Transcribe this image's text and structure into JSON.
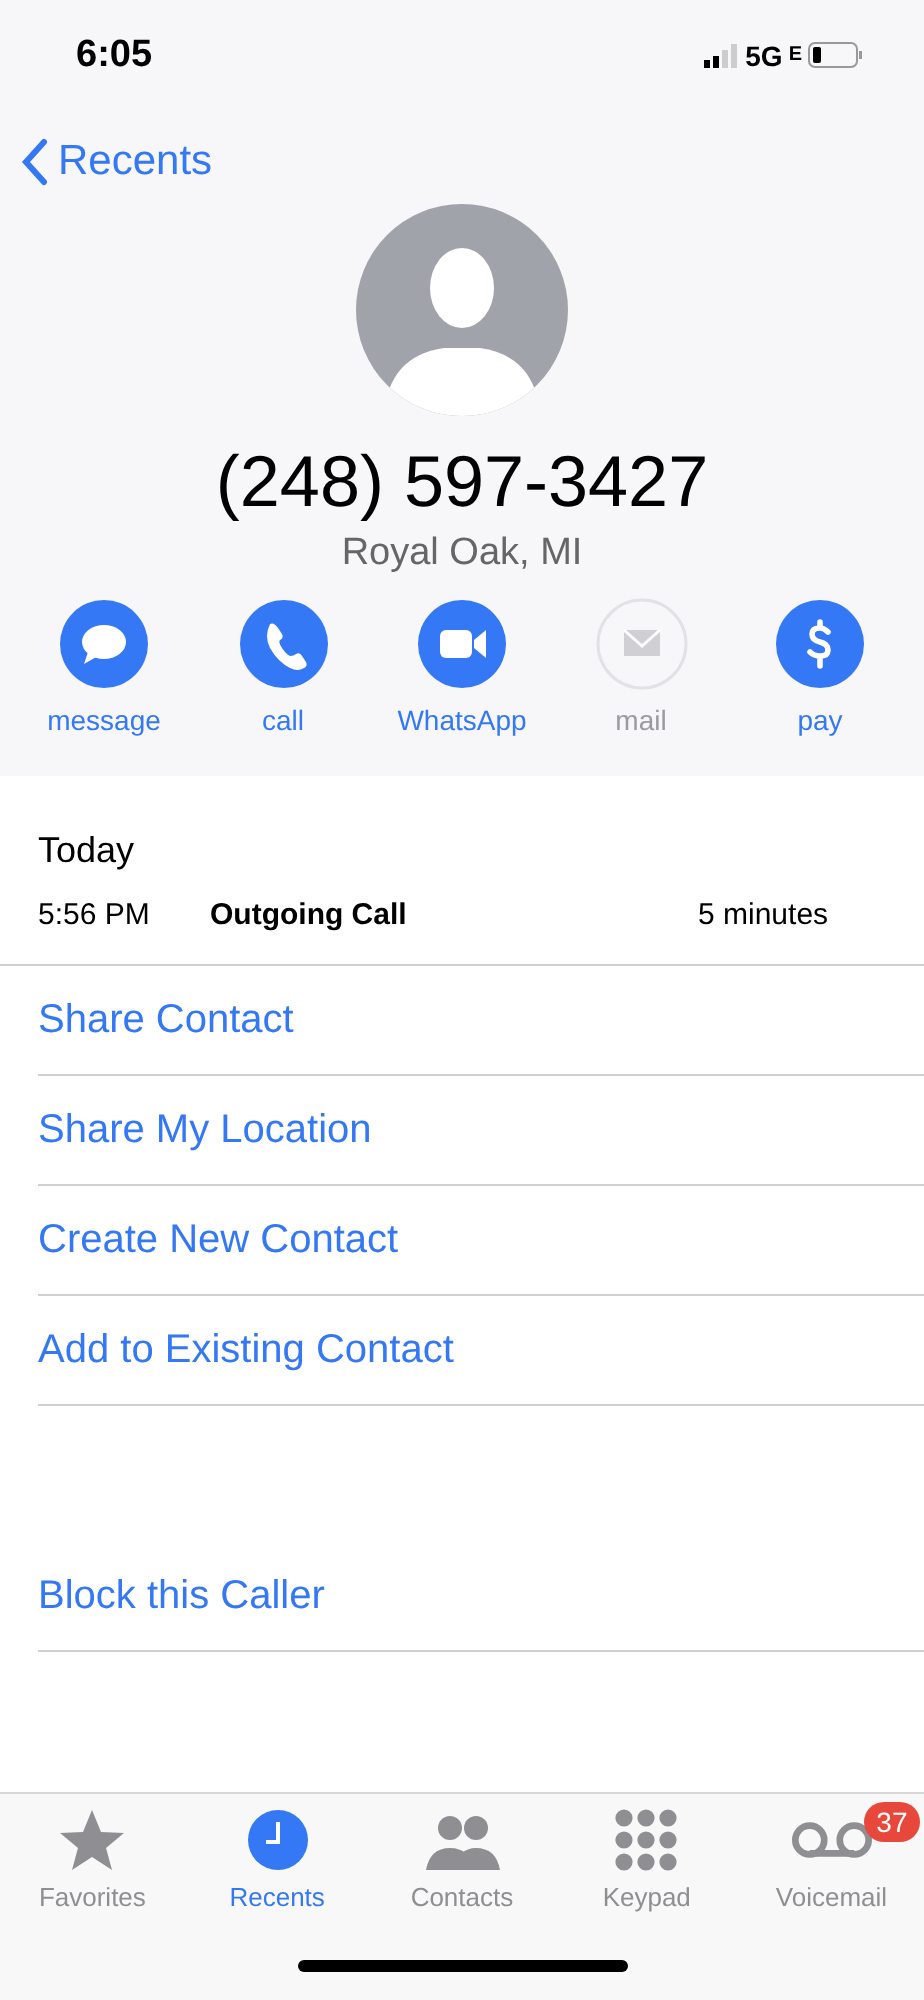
{
  "status_bar": {
    "time": "6:05",
    "network": "5G",
    "network_suffix": "E"
  },
  "nav": {
    "back_label": "Recents"
  },
  "contact": {
    "phone": "(248) 597-3427",
    "location": "Royal Oak, MI"
  },
  "actions": [
    {
      "kind": "message",
      "label": "message",
      "disabled": false
    },
    {
      "kind": "call",
      "label": "call",
      "disabled": false
    },
    {
      "kind": "video",
      "label": "WhatsApp",
      "disabled": false
    },
    {
      "kind": "mail",
      "label": "mail",
      "disabled": true
    },
    {
      "kind": "pay",
      "label": "pay",
      "disabled": false
    }
  ],
  "history": {
    "heading": "Today",
    "calls": [
      {
        "time": "5:56 PM",
        "type": "Outgoing Call",
        "duration": "5 minutes"
      }
    ]
  },
  "options": [
    {
      "label": "Share Contact"
    },
    {
      "label": "Share My Location"
    },
    {
      "label": "Create New Contact"
    },
    {
      "label": "Add to Existing Contact"
    }
  ],
  "block": {
    "label": "Block this Caller"
  },
  "tabs": [
    {
      "kind": "favorites",
      "label": "Favorites",
      "selected": false
    },
    {
      "kind": "recents",
      "label": "Recents",
      "selected": true
    },
    {
      "kind": "contacts",
      "label": "Contacts",
      "selected": false
    },
    {
      "kind": "keypad",
      "label": "Keypad",
      "selected": false
    },
    {
      "kind": "voicemail",
      "label": "Voicemail",
      "selected": false,
      "badge": "37"
    }
  ]
}
